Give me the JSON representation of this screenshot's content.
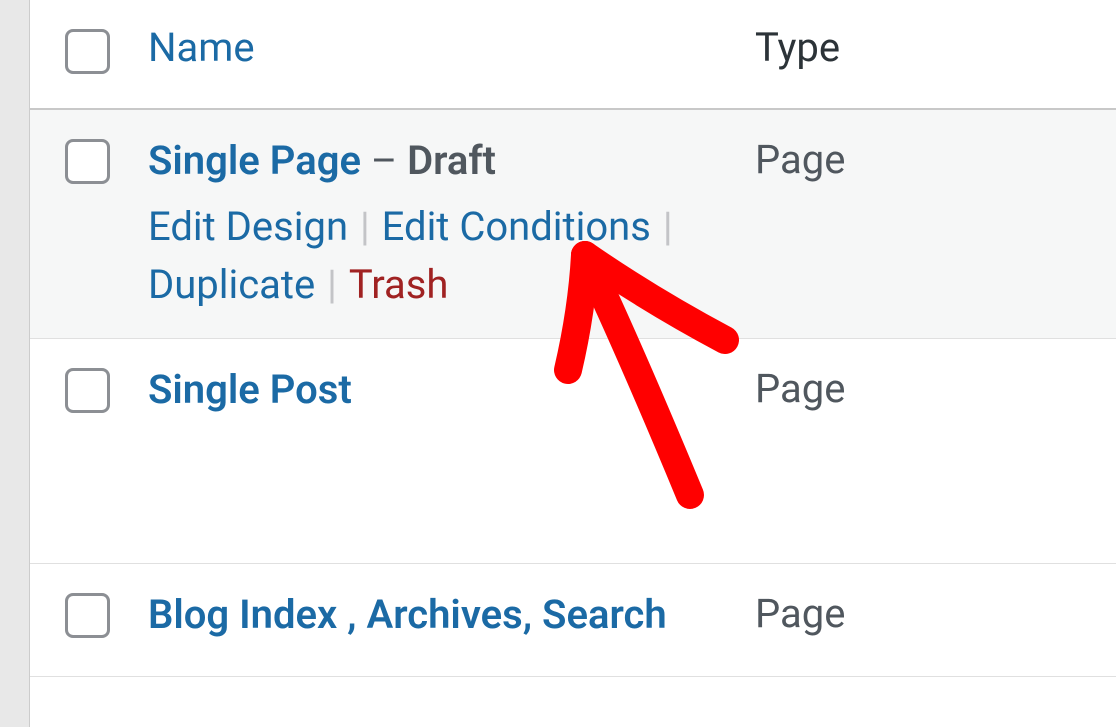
{
  "columns": {
    "name": "Name",
    "type": "Type"
  },
  "rows": [
    {
      "title": "Single Page",
      "status": "Draft",
      "type": "Page",
      "actions": {
        "edit_design": "Edit Design",
        "edit_conditions": "Edit Conditions",
        "duplicate": "Duplicate",
        "trash": "Trash"
      }
    },
    {
      "title": "Single Post",
      "type": "Page"
    },
    {
      "title": "Blog Index , Archives, Search",
      "type": "Page"
    }
  ]
}
